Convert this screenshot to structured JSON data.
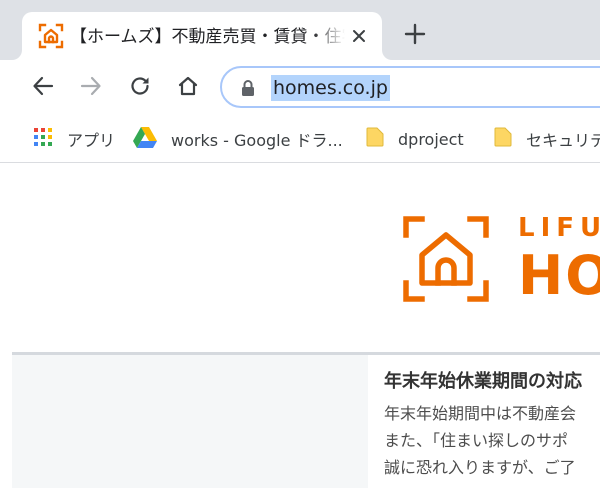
{
  "tab": {
    "title": "【ホームズ】不動産売買・賃貸・住宅情",
    "favicon": "homes-house-icon",
    "close_icon": "close-icon"
  },
  "toolbar": {
    "back_icon": "back-arrow-icon",
    "forward_icon": "forward-arrow-icon",
    "reload_icon": "reload-icon",
    "home_icon": "home-icon",
    "new_tab_icon": "plus-icon"
  },
  "omnibox": {
    "url": "homes.co.jp",
    "lock_icon": "lock-icon"
  },
  "bookmarks": [
    {
      "label": "アプリ",
      "icon": "apps-grid-icon"
    },
    {
      "label": "works - Google ドラ...",
      "icon": "google-drive-icon"
    },
    {
      "label": "dproject",
      "icon": "folder-icon"
    },
    {
      "label": "セキュリティ",
      "icon": "folder-icon"
    }
  ],
  "page": {
    "logo_top": "LIFULL",
    "logo_bottom": "HOME'S",
    "notice": {
      "title": "年末年始休業期間の対応",
      "lines": [
        "年末年始期間中は不動産会",
        "また、「住まい探しのサポ",
        "誠に恐れ入りますが、ご了"
      ]
    }
  },
  "colors": {
    "brand_orange": "#ed6c00",
    "tabstrip": "#dee1e6",
    "url_highlight": "#b3d4fc",
    "omnibox_border": "#a8c7fa"
  }
}
